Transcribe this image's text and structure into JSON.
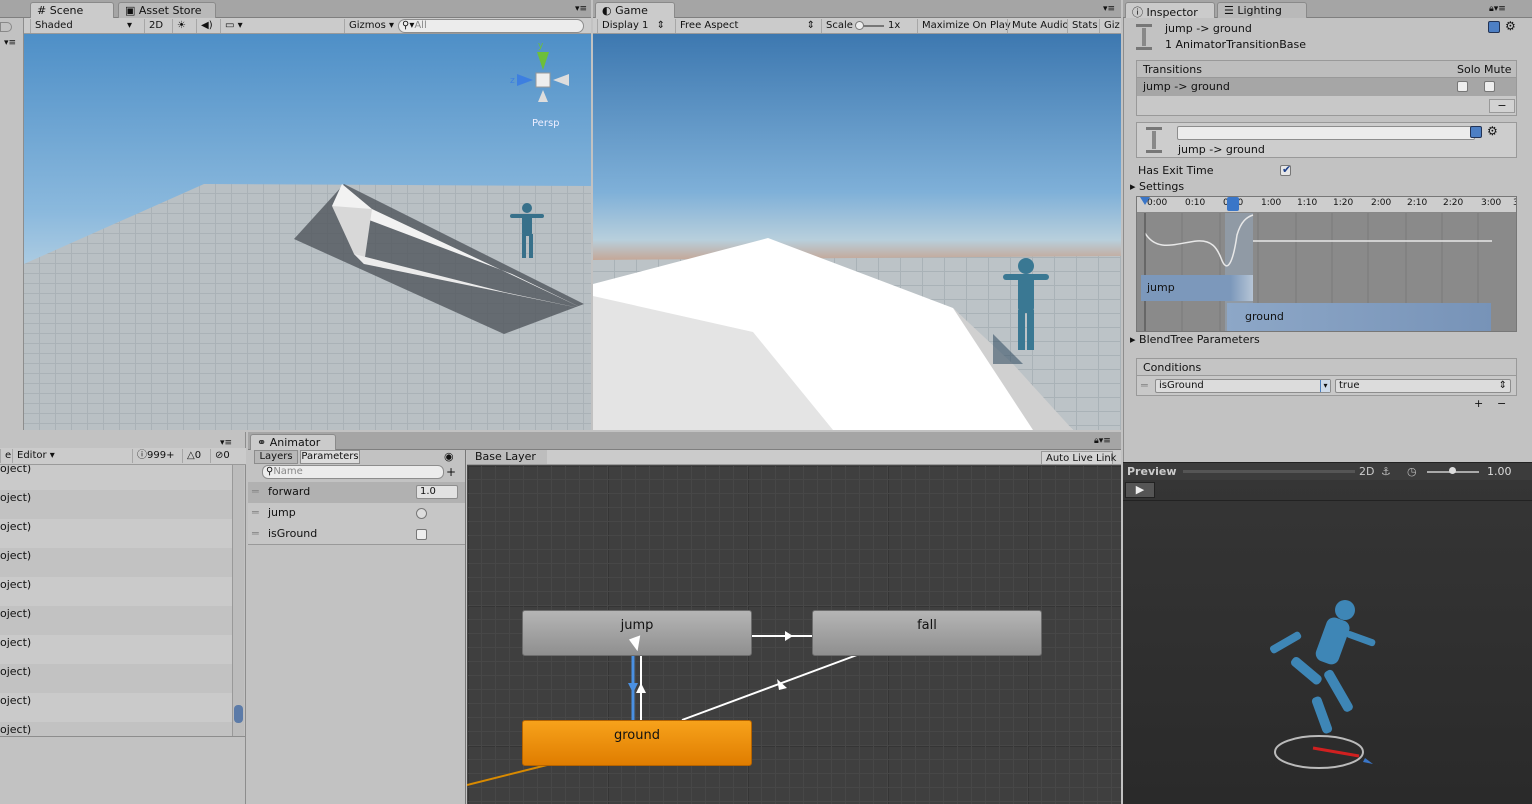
{
  "scene": {
    "tab": "Scene",
    "asset_store_tab": "Asset Store",
    "shading": "Shaded",
    "mode_2d": "2D",
    "gizmos": "Gizmos",
    "search_placeholder": "All",
    "persp": "Persp",
    "gizmo_axes": {
      "y": "y",
      "z": "z"
    }
  },
  "game": {
    "tab": "Game",
    "display": "Display 1",
    "aspect": "Free Aspect",
    "scale_label": "Scale",
    "scale_value": "1x",
    "maximize": "Maximize On Play",
    "mute": "Mute Audio",
    "stats": "Stats",
    "gizmos": "Giz"
  },
  "hierarchy": {
    "left_dropdown": "e",
    "editor": "Editor",
    "count_info": "999+",
    "count_warn": "0",
    "count_error": "0",
    "rows": [
      "oject)",
      "oject)",
      "oject)",
      "oject)",
      "oject)",
      "oject)",
      "oject)",
      "oject)",
      "oject)",
      "oject)"
    ]
  },
  "animator": {
    "tab": "Animator",
    "layers_tab": "Layers",
    "parameters_tab": "Parameters",
    "name_placeholder": "Name",
    "base_layer": "Base Layer",
    "auto_live_link": "Auto Live Link",
    "parameters": [
      {
        "name": "forward",
        "value": "1.0"
      },
      {
        "name": "jump",
        "value": ""
      },
      {
        "name": "isGround",
        "value": ""
      }
    ],
    "states": {
      "jump": "jump",
      "fall": "fall",
      "ground": "ground"
    }
  },
  "inspector": {
    "tab": "Inspector",
    "lighting_tab": "Lighting",
    "title": "jump -> ground",
    "subtitle": "1 AnimatorTransitionBase",
    "transitions_header": "Transitions",
    "solo": "Solo",
    "mute": "Mute",
    "transition_row": "jump -> ground",
    "transition_name": "jump -> ground",
    "has_exit_time": "Has Exit Time",
    "settings": "Settings",
    "timeline_ticks": [
      "0:00",
      "0:10",
      "0:20",
      "1:00",
      "1:10",
      "1:20",
      "2:00",
      "2:10",
      "2:20",
      "3:00",
      "3"
    ],
    "clip_jump": "jump",
    "clip_ground": "ground",
    "blendtree": "BlendTree Parameters",
    "conditions_header": "Conditions",
    "condition_param": "isGround",
    "condition_value": "true",
    "plus": "+",
    "minus": "−"
  },
  "preview": {
    "title": "Preview",
    "mode_2d": "2D",
    "speed": "1.00"
  },
  "colors": {
    "default_state": "#f29300",
    "transition_selected": "#4a90e2",
    "panel": "#c2c2c2"
  }
}
